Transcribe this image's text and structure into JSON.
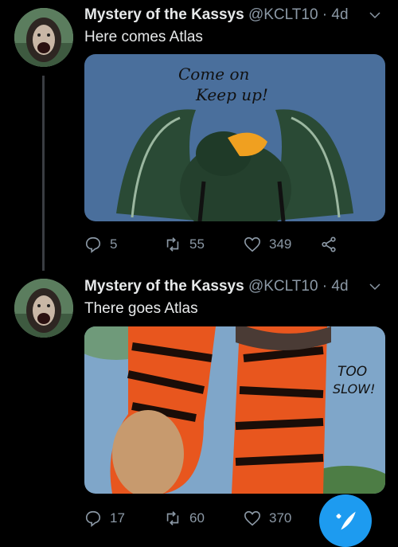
{
  "tweets": [
    {
      "name": "Mystery of the Kassys",
      "handle": "@KCLT10",
      "time": "· 4d",
      "text": "Here comes Atlas",
      "image_caption": [
        "Come on",
        "Keep up!"
      ],
      "replies": "5",
      "retweets": "55",
      "likes": "349"
    },
    {
      "name": "Mystery of the Kassys",
      "handle": "@KCLT10",
      "time": "· 4d",
      "text": "There goes Atlas",
      "image_caption": [
        "TOO",
        "SLOW!"
      ],
      "replies": "17",
      "retweets": "60",
      "likes": "370"
    }
  ],
  "colors": {
    "accent": "#1d9bf0",
    "muted": "#8b98a5",
    "background": "#000000"
  },
  "icons": [
    "reply-icon",
    "retweet-icon",
    "like-icon",
    "share-icon",
    "chevron-down-icon",
    "compose-icon"
  ]
}
